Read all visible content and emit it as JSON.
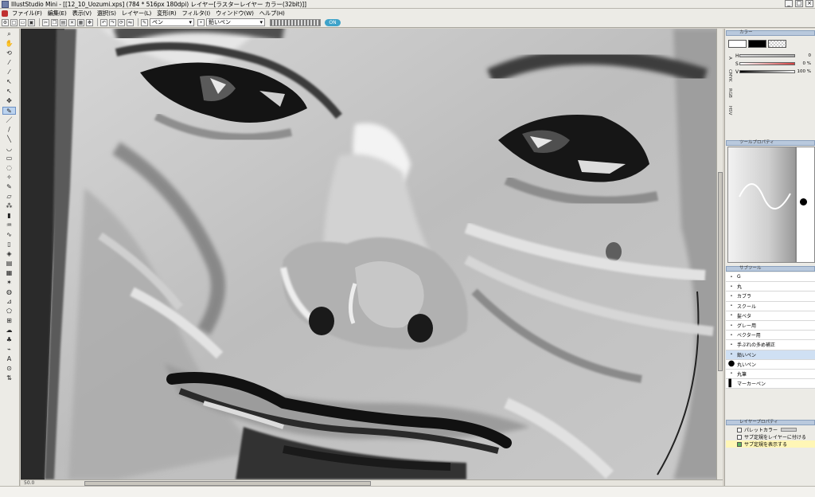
{
  "window": {
    "title": "IllustStudio Mini - [[12_10_Uozumi.xps] (784 * 516px 180dpi)  レイヤー[ラスターレイヤー カラー(32bit)]]",
    "controls": [
      "_",
      "□",
      "×"
    ]
  },
  "menu": [
    "ファイル(F)",
    "編集(E)",
    "表示(V)",
    "選択(S)",
    "レイヤー(L)",
    "変形(R)",
    "フィルタ(I)",
    "ウィンドウ(W)",
    "ヘルプ(H)"
  ],
  "toolbar": {
    "tool_select": "ペン",
    "subtool_select": "鉛いペン",
    "badge": "ON"
  },
  "color_panel": {
    "title": "カラー",
    "tabs": [
      "HSV",
      "RGB",
      "CMYK",
      "A"
    ],
    "sliders": [
      {
        "label": "H",
        "value": "0",
        "color": "#c0c0c0"
      },
      {
        "label": "S",
        "value": "0 %",
        "color": "#d34040"
      },
      {
        "label": "V",
        "value": "100 %",
        "color": "#222222"
      }
    ]
  },
  "tool_props": {
    "title": "ツールプロパティ"
  },
  "subtool_panel": {
    "title": "サブツール",
    "items": [
      {
        "label": "G",
        "mark": "•",
        "selected": false
      },
      {
        "label": "丸",
        "mark": "•",
        "selected": false
      },
      {
        "label": "カブラ",
        "mark": "•",
        "selected": false
      },
      {
        "label": "スクール",
        "mark": "•",
        "selected": false
      },
      {
        "label": "髪ベタ",
        "mark": "•",
        "selected": false
      },
      {
        "label": "グレー用",
        "mark": "•",
        "selected": false
      },
      {
        "label": "ベクター用",
        "mark": "•",
        "selected": false
      },
      {
        "label": "手ぶれの多め補正",
        "mark": "•",
        "selected": false
      },
      {
        "label": "鉛いペン",
        "mark": "•",
        "selected": true
      },
      {
        "label": "丸いペン",
        "mark": "●",
        "selected": false
      },
      {
        "label": "丸筆",
        "mark": "•",
        "selected": false
      },
      {
        "label": "マーカーペン",
        "mark": "▌",
        "selected": false
      }
    ]
  },
  "layer_props": {
    "title": "レイヤープロパティ",
    "rows": [
      {
        "label": "パレットカラー",
        "checked": false
      },
      {
        "label": "サブ定規をレイヤーに付ける",
        "checked": false
      },
      {
        "label": "サブ定規を表示する",
        "checked": true
      }
    ]
  },
  "status": {
    "zoom": "50.0"
  }
}
